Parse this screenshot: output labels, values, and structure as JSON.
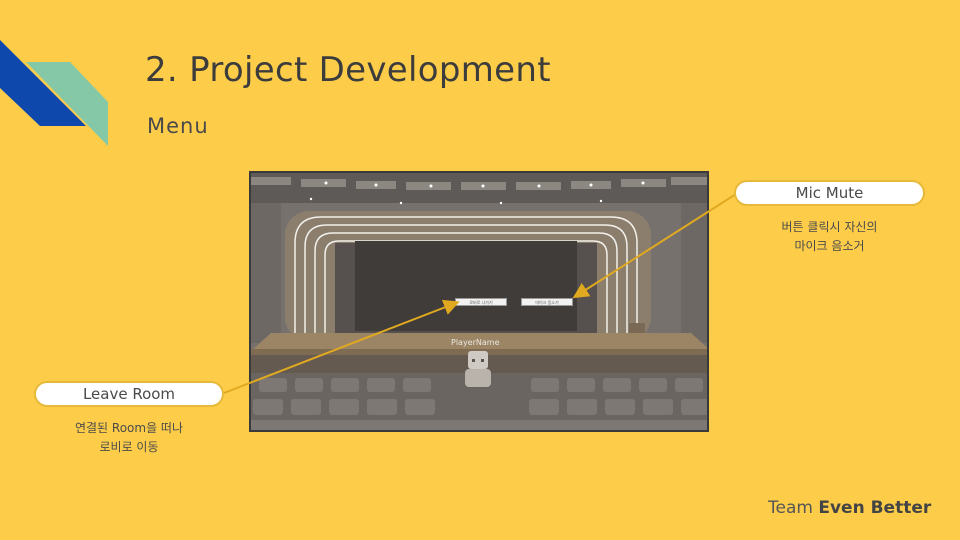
{
  "slide": {
    "title": "2. Project Development",
    "subtitle": "Menu"
  },
  "screenshot": {
    "leave_button_label": "로비로 나가기",
    "mic_button_label": "마이크 음소거",
    "player_name": "PlayerName"
  },
  "callouts": {
    "leave_room": {
      "label": "Leave Room",
      "desc_line1": "연결된 Room을 떠나",
      "desc_line2": "로비로 이동"
    },
    "mic_mute": {
      "label": "Mic Mute",
      "desc_line1": "버튼 클릭시 자신의",
      "desc_line2": "마이크 음소거"
    }
  },
  "footer": {
    "team_prefix": "Team ",
    "team_name": "Even Better"
  },
  "colors": {
    "background": "#fdcd4a",
    "accent_blue": "#0f48ad",
    "accent_teal": "#84c8a8",
    "arrow": "#e0a920"
  }
}
